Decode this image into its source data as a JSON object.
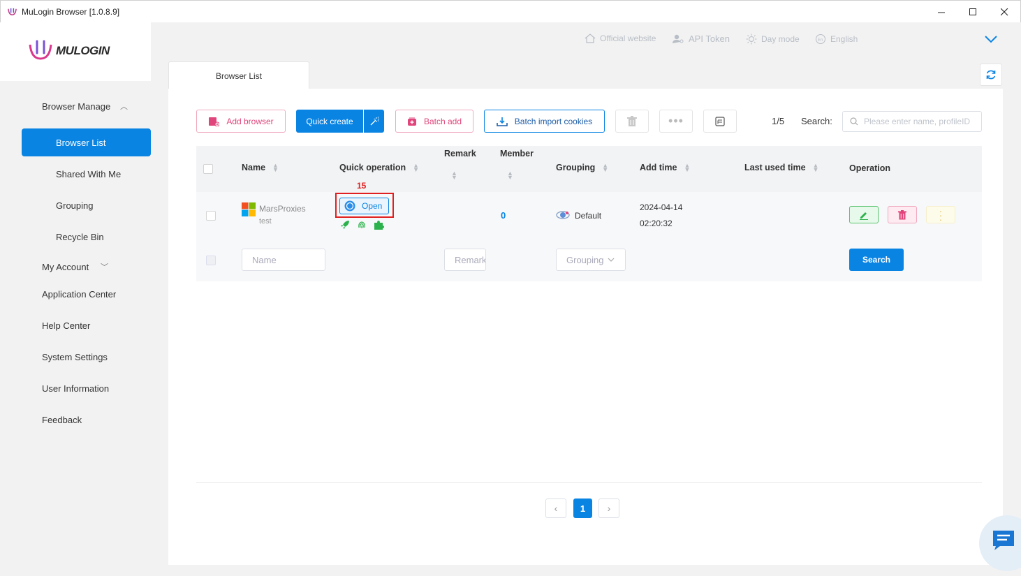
{
  "window": {
    "title": "MuLogin Browser  [1.0.8.9]",
    "controls": [
      "minimize",
      "maximize",
      "close"
    ]
  },
  "brand": {
    "logo_text": "MULOGIN"
  },
  "header": {
    "links": [
      {
        "label": "Official website",
        "icon": "home-icon"
      },
      {
        "label": "API Token",
        "icon": "user-key-icon"
      },
      {
        "label": "Day mode",
        "icon": "sun-icon"
      },
      {
        "label": "English",
        "icon": "language-icon"
      }
    ]
  },
  "sidebar": {
    "browser_manage": "Browser Manage",
    "items": [
      {
        "label": "Browser List",
        "active": true
      },
      {
        "label": "Shared With Me"
      },
      {
        "label": "Grouping"
      },
      {
        "label": "Recycle Bin"
      }
    ],
    "my_account": "My Account",
    "application_center": "Application Center",
    "help_center": "Help Center",
    "system_settings": "System Settings",
    "user_information": "User Information",
    "feedback": "Feedback"
  },
  "tabs": {
    "browser_list": "Browser List"
  },
  "toolbar": {
    "add_browser": "Add browser",
    "quick_create": "Quick create",
    "batch_add": "Batch add",
    "batch_import_cookies": "Batch import cookies",
    "page_counter": "1/5",
    "search_label": "Search:",
    "search_placeholder": "Please enter name, profileID"
  },
  "table": {
    "columns": {
      "name": "Name",
      "quick_operation": "Quick operation",
      "remark": "Remark",
      "member": "Member",
      "grouping": "Grouping",
      "add_time": "Add time",
      "last_used_time": "Last used time",
      "operation": "Operation"
    },
    "rows": [
      {
        "name": "MarsProxies",
        "subname": "test",
        "os": "windows",
        "quick_op_label": "Open",
        "annotation": "15",
        "member": "0",
        "grouping": "Default",
        "add_date": "2024-04-14",
        "add_time": "02:20:32"
      }
    ],
    "filters": {
      "name_placeholder": "Name",
      "remark_placeholder": "Remark",
      "grouping_placeholder": "Grouping",
      "search_button": "Search"
    }
  },
  "pagination": {
    "current": "1",
    "prev": "‹",
    "next": "›"
  },
  "colors": {
    "accent": "#0a84e3",
    "pink": "#e0457b",
    "green": "#2cb24c",
    "annotation_red": "#e02020"
  }
}
